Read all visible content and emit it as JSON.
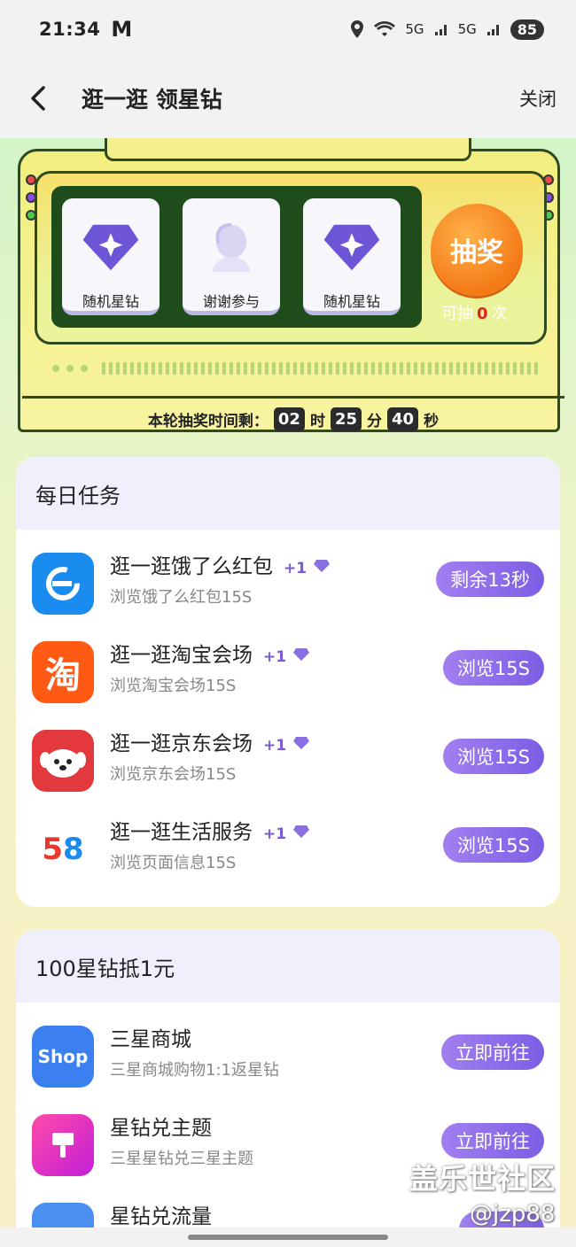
{
  "status_bar": {
    "time": "21:34",
    "mail_glyph": "M",
    "network_1": "5G",
    "network_2": "5G",
    "battery": "85"
  },
  "header": {
    "title": "逛一逛 领星钻",
    "close_label": "关闭"
  },
  "lottery": {
    "reels": [
      {
        "label": "随机星钻",
        "icon": "diamond-icon"
      },
      {
        "label": "谢谢参与",
        "icon": "thanks-icon"
      },
      {
        "label": "随机星钻",
        "icon": "diamond-icon"
      }
    ],
    "draw_button_label": "抽奖",
    "remaining_prefix": "可抽",
    "remaining_count": "0",
    "remaining_suffix": "次",
    "timer_label": "本轮抽奖时间剩：",
    "timer_hours": "02",
    "timer_hours_unit": "时",
    "timer_minutes": "25",
    "timer_minutes_unit": "分",
    "timer_seconds": "40",
    "timer_seconds_unit": "秒"
  },
  "daily_tasks": {
    "title": "每日任务",
    "items": [
      {
        "title": "逛一逛饿了么红包",
        "reward": "+1",
        "desc": "浏览饿了么红包15S",
        "button": "剩余13秒",
        "icon": "eleme-icon"
      },
      {
        "title": "逛一逛淘宝会场",
        "reward": "+1",
        "desc": "浏览淘宝会场15S",
        "button": "浏览15S",
        "icon": "taobao-icon"
      },
      {
        "title": "逛一逛京东会场",
        "reward": "+1",
        "desc": "浏览京东会场15S",
        "button": "浏览15S",
        "icon": "jd-icon"
      },
      {
        "title": "逛一逛生活服务",
        "reward": "+1",
        "desc": "浏览页面信息15S",
        "button": "浏览15S",
        "icon": "58-icon"
      }
    ]
  },
  "redeem": {
    "title": "100星钻抵1元",
    "items": [
      {
        "title": "三星商城",
        "desc": "三星商城购物1:1返星钻",
        "button": "立即前往",
        "icon_text": "Shop"
      },
      {
        "title": "星钻兑主题",
        "desc": "三星星钻兑三星主题",
        "button": "立即前往"
      },
      {
        "title": "星钻兑流量"
      }
    ]
  },
  "watermark": {
    "line1": "盖乐世社区",
    "line2": "@jzp88"
  },
  "colors": {
    "accent_purple": "#7c5ee4",
    "draw_orange": "#f47a16",
    "reel_board": "#1e4d1b"
  }
}
